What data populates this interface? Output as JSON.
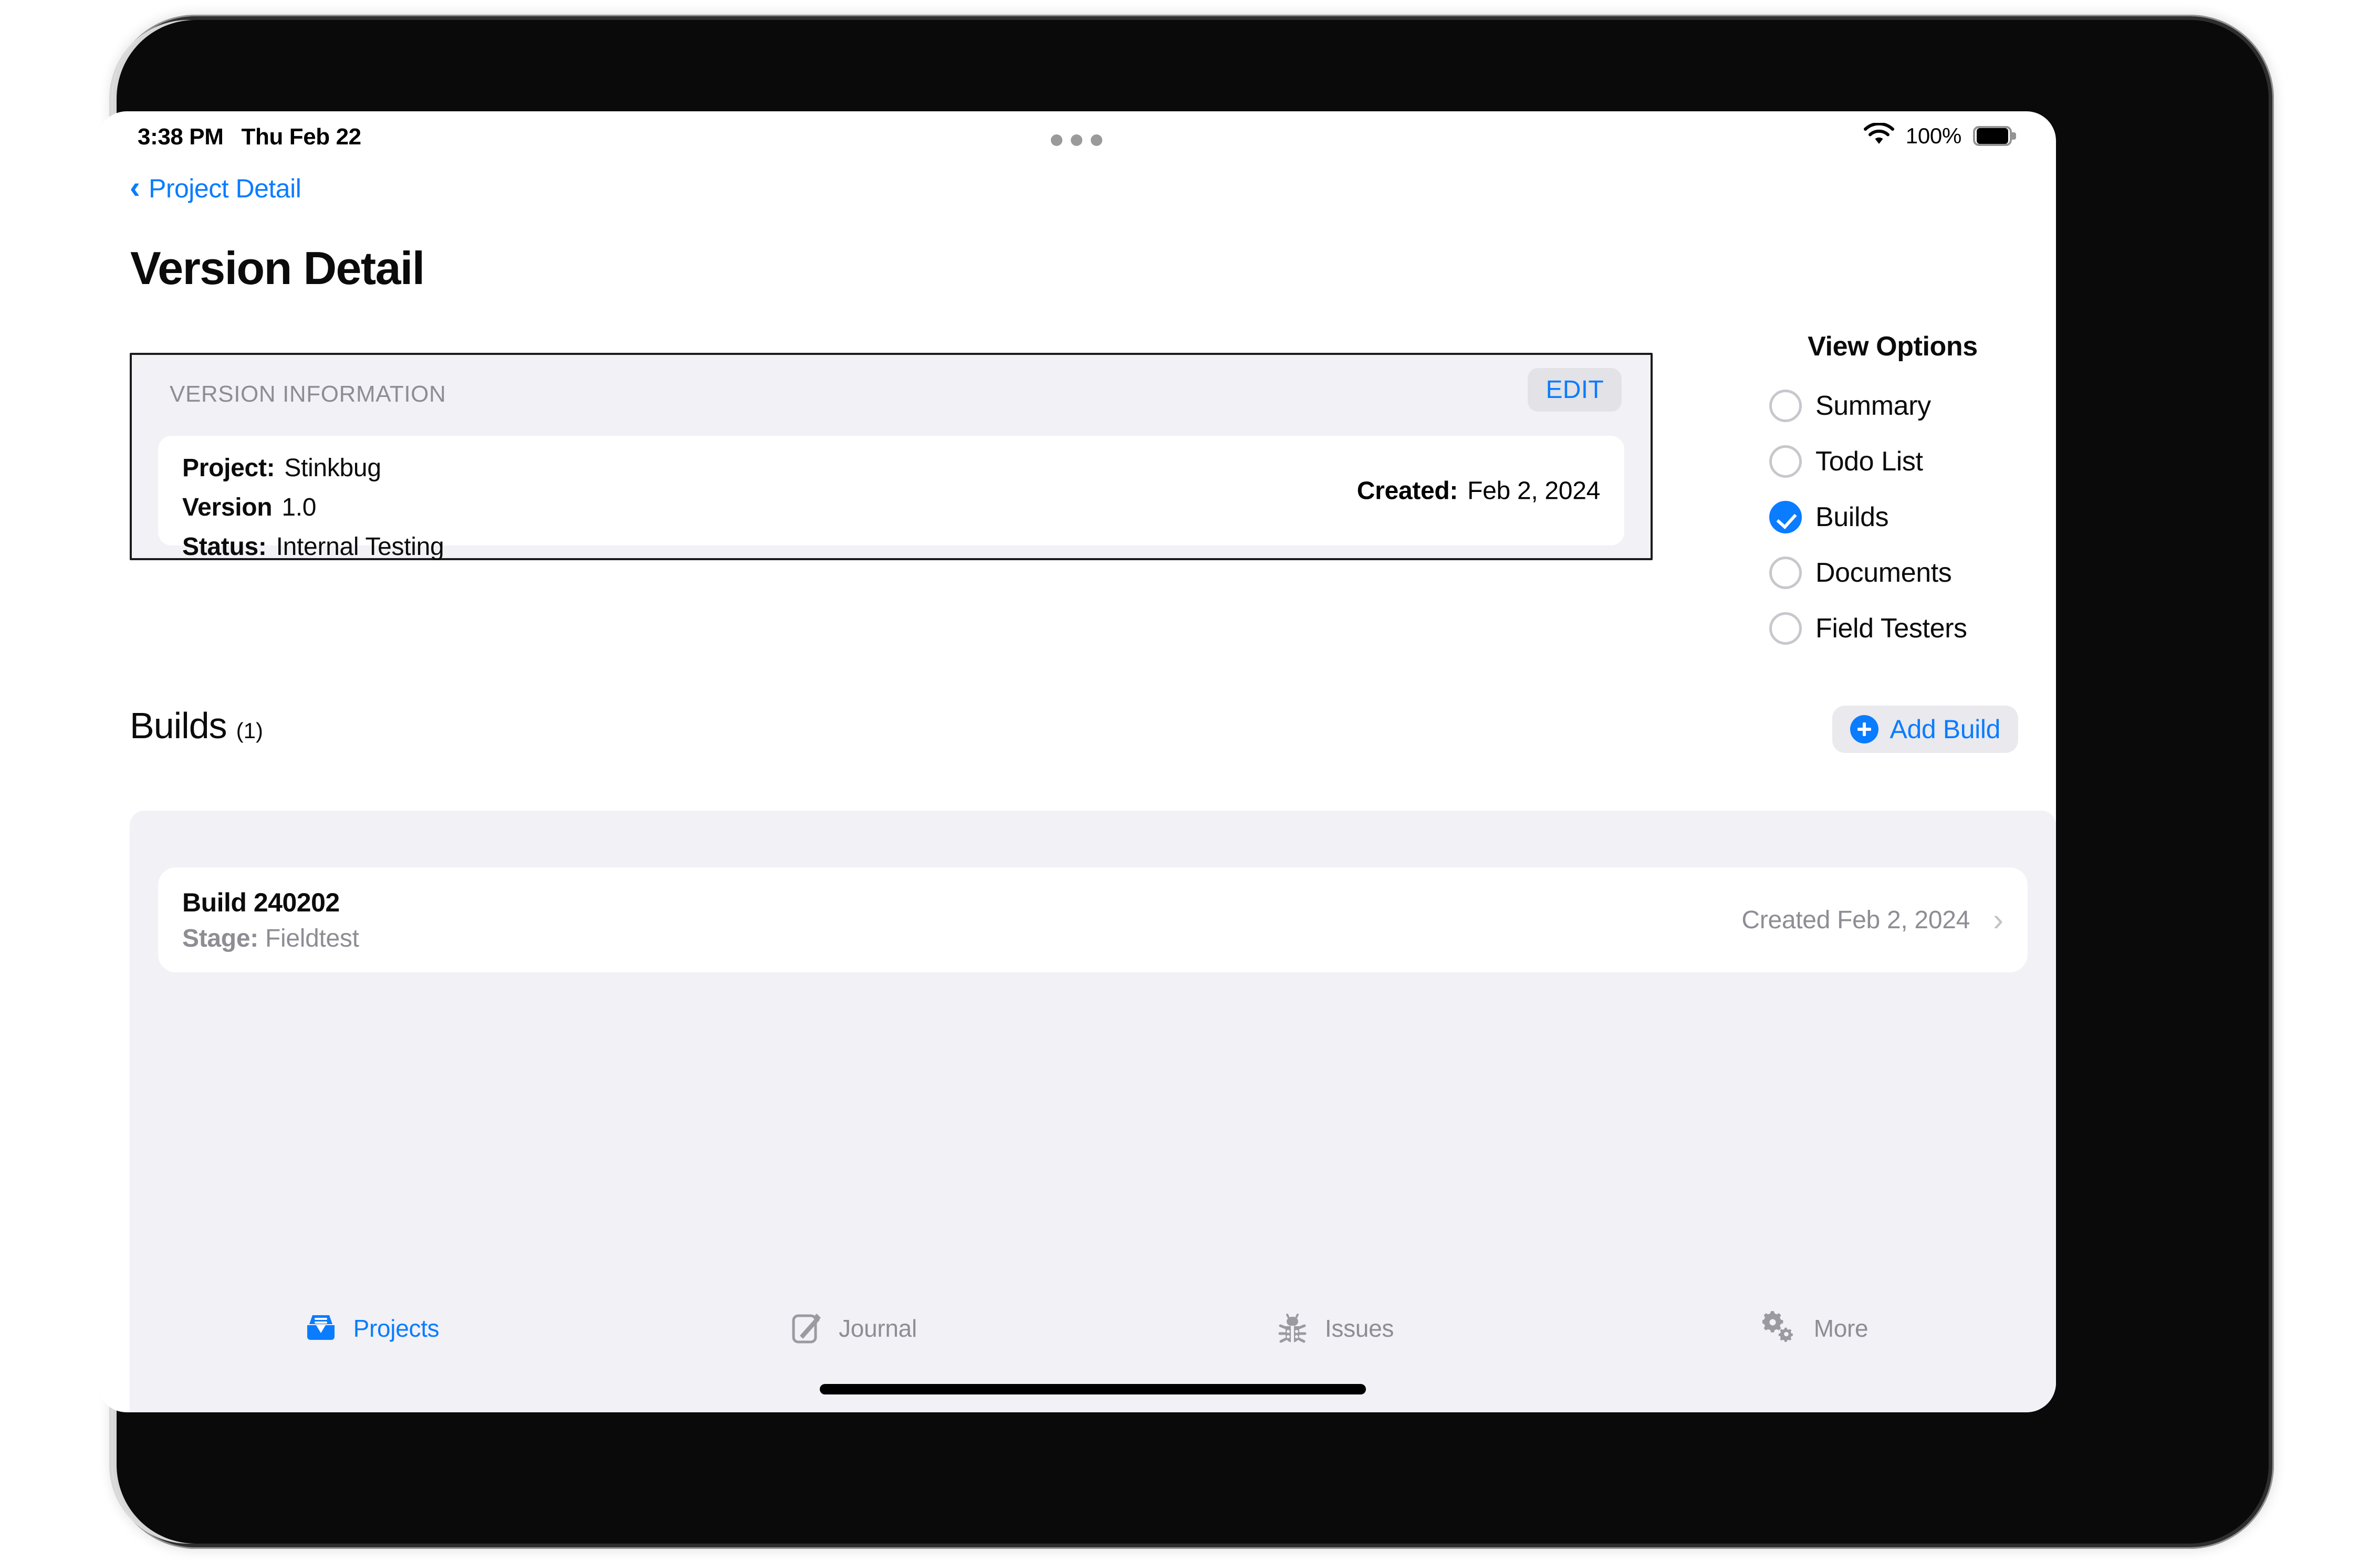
{
  "status_bar": {
    "time": "3:38 PM",
    "date": "Thu Feb 22",
    "battery_percent": "100%",
    "wifi_icon": "wifi-icon",
    "battery_icon": "battery-icon",
    "dots_icon": "three-dots-icon"
  },
  "nav": {
    "back_label": "Project Detail",
    "back_icon": "chevron-left-icon"
  },
  "page": {
    "title": "Version Detail"
  },
  "version_info": {
    "header": "VERSION INFORMATION",
    "edit_label": "EDIT",
    "rows": [
      {
        "key": "Project:",
        "value": "Stinkbug"
      },
      {
        "key": "Version",
        "value": "1.0"
      },
      {
        "key": "Status:",
        "value": "Internal Testing"
      }
    ],
    "created_key": "Created:",
    "created_value": "Feb 2, 2024"
  },
  "view_options": {
    "title": "View Options",
    "items": [
      {
        "label": "Summary",
        "selected": false
      },
      {
        "label": "Todo List",
        "selected": false
      },
      {
        "label": "Builds",
        "selected": true
      },
      {
        "label": "Documents",
        "selected": false
      },
      {
        "label": "Field Testers",
        "selected": false
      }
    ]
  },
  "builds_section": {
    "title": "Builds",
    "count": "(1)",
    "add_button_label": "Add Build",
    "add_button_icon": "plus-circle-icon",
    "rows": [
      {
        "title": "Build 240202",
        "stage_key": "Stage:",
        "stage_value": "Fieldtest",
        "created": "Created Feb 2, 2024",
        "chevron_icon": "chevron-right-icon"
      }
    ]
  },
  "tab_bar": {
    "items": [
      {
        "label": "Projects",
        "icon": "inbox-tray-icon",
        "active": true
      },
      {
        "label": "Journal",
        "icon": "note-pencil-icon",
        "active": false
      },
      {
        "label": "Issues",
        "icon": "bug-icon",
        "active": false
      },
      {
        "label": "More",
        "icon": "gears-icon",
        "active": false
      }
    ]
  },
  "colors": {
    "accent": "#0a7cff",
    "panel": "#f1f1f6",
    "muted_text": "#8d8d94"
  }
}
